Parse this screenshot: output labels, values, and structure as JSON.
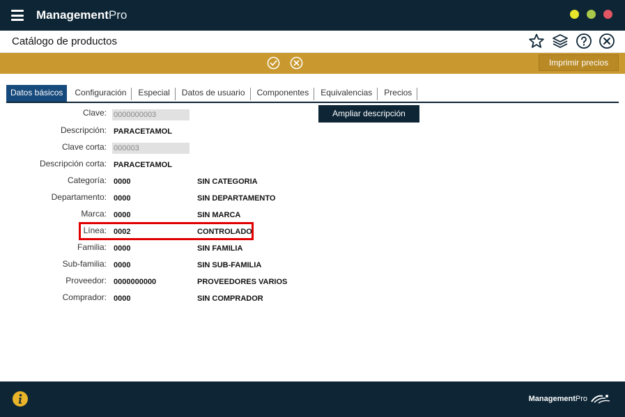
{
  "app": {
    "name_bold": "Management",
    "name_light": "Pro",
    "window_dots": [
      "#e8e62a",
      "#a9c94a",
      "#e25563"
    ]
  },
  "header": {
    "title": "Catálogo de productos",
    "icons": [
      "star-icon",
      "layers-icon",
      "help-icon",
      "close-icon"
    ]
  },
  "actionbar": {
    "icons": [
      "check-icon",
      "cancel-icon"
    ],
    "print_label": "Imprimir precios"
  },
  "tabs": [
    {
      "label": "Datos básicos",
      "active": true
    },
    {
      "label": "Configuración",
      "active": false
    },
    {
      "label": "Especial",
      "active": false
    },
    {
      "label": "Datos de usuario",
      "active": false
    },
    {
      "label": "Componentes",
      "active": false
    },
    {
      "label": "Equivalencias",
      "active": false
    },
    {
      "label": "Precios",
      "active": false
    }
  ],
  "form": {
    "clave": {
      "label": "Clave:",
      "value": "0000000003"
    },
    "descripcion": {
      "label": "Descripción:",
      "value": "PARACETAMOL"
    },
    "clave_corta": {
      "label": "Clave corta:",
      "value": "000003"
    },
    "descripcion_corta": {
      "label": "Descripción corta:",
      "value": "PARACETAMOL"
    },
    "categoria": {
      "label": "Categoría:",
      "code": "0000",
      "desc": "SIN CATEGORIA"
    },
    "departamento": {
      "label": "Departamento:",
      "code": "0000",
      "desc": "SIN DEPARTAMENTO"
    },
    "marca": {
      "label": "Marca:",
      "code": "0000",
      "desc": "SIN MARCA"
    },
    "linea": {
      "label": "Línea:",
      "code": "0002",
      "desc": "CONTROLADO"
    },
    "familia": {
      "label": "Familia:",
      "code": "0000",
      "desc": "SIN FAMILIA"
    },
    "subfamilia": {
      "label": "Sub-familia:",
      "code": "0000",
      "desc": "SIN SUB-FAMILIA"
    },
    "proveedor": {
      "label": "Proveedor:",
      "code": "0000000000",
      "desc": "PROVEEDORES VARIOS"
    },
    "comprador": {
      "label": "Comprador:",
      "code": "0000",
      "desc": "SIN COMPRADOR"
    },
    "ampliar_label": "Ampliar descripción"
  },
  "footer": {
    "brand_bold": "Management",
    "brand_light": "Pro"
  },
  "colors": {
    "navy": "#0d2535",
    "gold": "#c9992f",
    "tab_active": "#174a7c",
    "highlight": "#e00000"
  }
}
